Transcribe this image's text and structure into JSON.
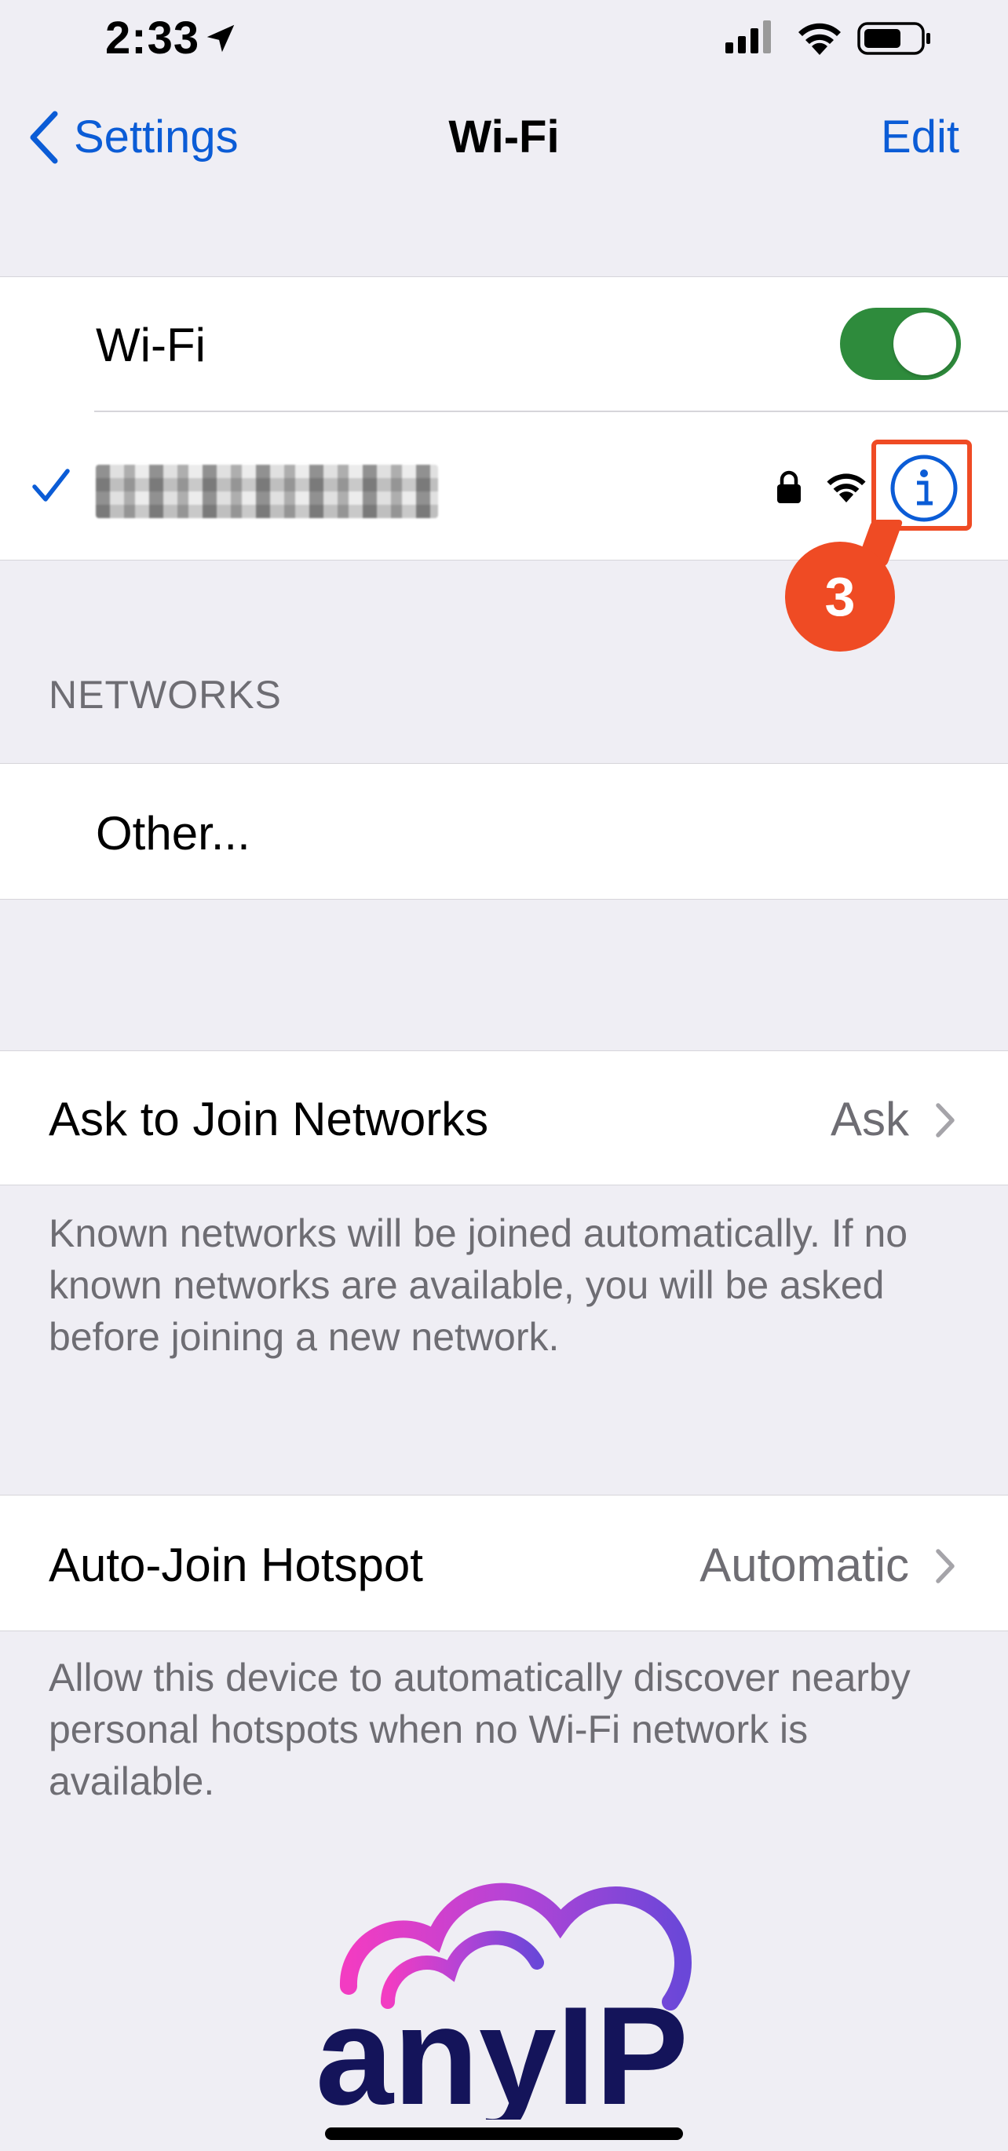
{
  "status_bar": {
    "time": "2:33",
    "icons": [
      "location-arrow-icon",
      "cellular-signal-icon",
      "wifi-icon",
      "battery-icon"
    ]
  },
  "nav": {
    "back_label": "Settings",
    "title": "Wi-Fi",
    "edit_label": "Edit"
  },
  "wifi_toggle": {
    "label": "Wi-Fi",
    "on": true
  },
  "connected_network": {
    "name": "",
    "secured": true,
    "icons": [
      "checkmark-icon",
      "lock-icon",
      "wifi-icon",
      "info-icon"
    ]
  },
  "annotation": {
    "step": "3"
  },
  "networks": {
    "section_label": "NETWORKS",
    "items": [
      {
        "label": "Other..."
      }
    ]
  },
  "ask_to_join": {
    "label": "Ask to Join Networks",
    "value": "Ask",
    "note": "Known networks will be joined automatically. If no known networks are available, you will be asked before joining a new network."
  },
  "auto_join_hotspot": {
    "label": "Auto-Join Hotspot",
    "value": "Automatic",
    "note": "Allow this device to automatically discover nearby personal hotspots when no Wi-Fi network is available."
  },
  "watermark": {
    "text": "anyIP"
  },
  "colors": {
    "accent": "#0b5cd6",
    "toggle_on": "#2e8b3c",
    "annotation": "#ef4b24",
    "background": "#efeef4"
  }
}
